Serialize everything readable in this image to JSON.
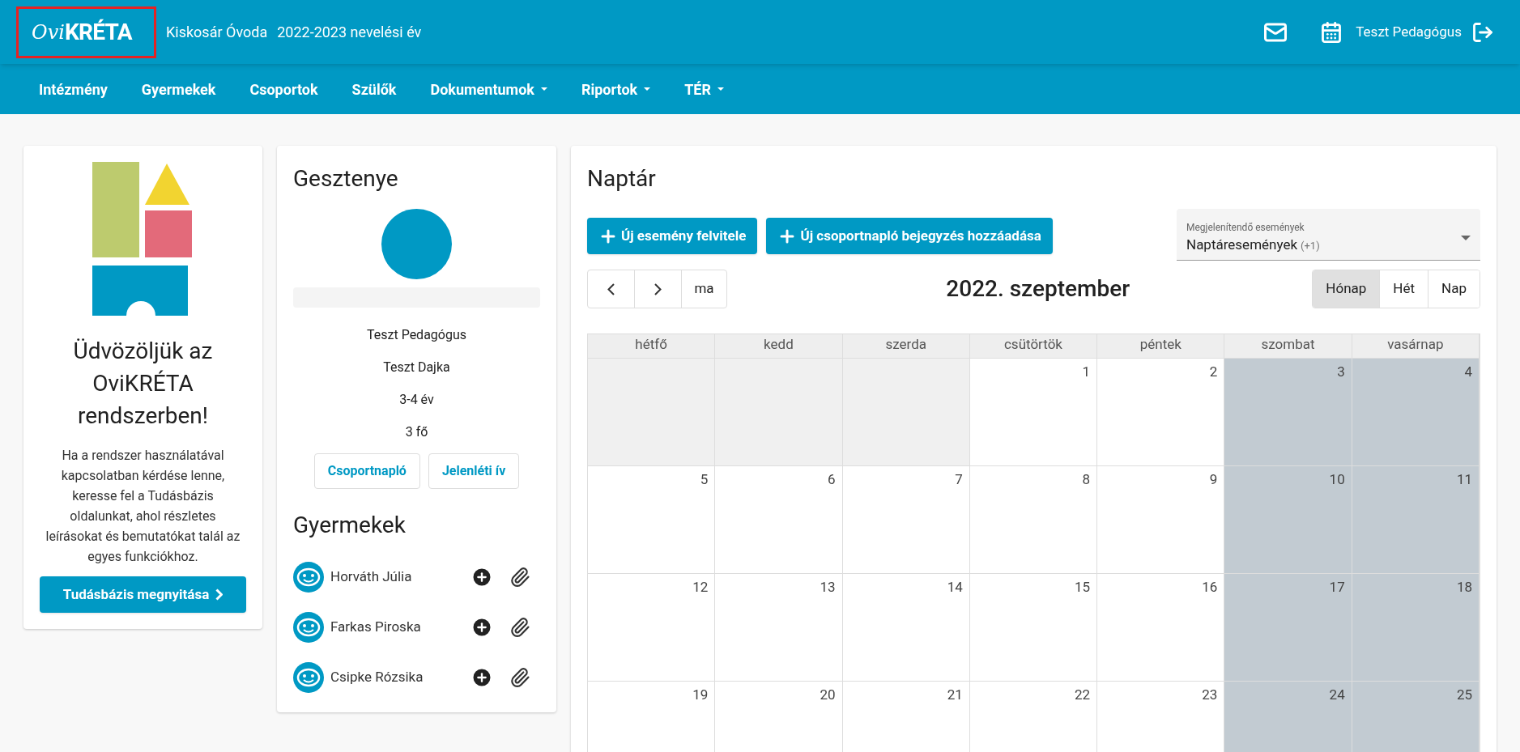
{
  "header": {
    "logo_prefix": "Ovi",
    "logo_main": "KRÉTA",
    "institution": "Kiskosár Óvoda",
    "year": "2022-2023 nevelési év",
    "user": "Teszt Pedagógus"
  },
  "nav": [
    {
      "label": "Intézmény",
      "dropdown": false
    },
    {
      "label": "Gyermekek",
      "dropdown": false
    },
    {
      "label": "Csoportok",
      "dropdown": false
    },
    {
      "label": "Szülők",
      "dropdown": false
    },
    {
      "label": "Dokumentumok",
      "dropdown": true
    },
    {
      "label": "Riportok",
      "dropdown": true
    },
    {
      "label": "TÉR",
      "dropdown": true
    }
  ],
  "welcome": {
    "title": "Üdvözöljük az OviKRÉTA rendszerben!",
    "text": "Ha a rendszer használatával kapcsolatban kérdése lenne, keresse fel a Tudásbázis oldalunkat, ahol részletes leírásokat és bemutatókat talál az egyes funkciókhoz.",
    "button": "Tudásbázis megnyitása"
  },
  "group": {
    "name": "Gesztenye",
    "details": [
      "Teszt Pedagógus",
      "Teszt Dajka",
      "3-4 év",
      "3 fő"
    ],
    "buttons": [
      "Csoportnapló",
      "Jelenléti ív"
    ],
    "children_title": "Gyermekek",
    "children": [
      {
        "name": "Horváth Júlia"
      },
      {
        "name": "Farkas Piroska"
      },
      {
        "name": "Csipke Rózsika"
      }
    ]
  },
  "calendar": {
    "title": "Naptár",
    "actions": [
      "Új esemény felvitele",
      "Új csoportnapló bejegyzés hozzáadása"
    ],
    "filter": {
      "label": "Megjelenítendő események",
      "value": "Naptáresemények",
      "extra": "(+1)"
    },
    "today": "ma",
    "month": "2022. szeptember",
    "views": [
      {
        "label": "Hónap",
        "selected": true
      },
      {
        "label": "Hét",
        "selected": false
      },
      {
        "label": "Nap",
        "selected": false
      }
    ],
    "weekdays": [
      "hétfő",
      "kedd",
      "szerda",
      "csütörtök",
      "péntek",
      "szombat",
      "vasárnap"
    ],
    "weeks": [
      [
        {
          "kind": "other"
        },
        {
          "kind": "other"
        },
        {
          "kind": "other"
        },
        {
          "kind": "day",
          "day": "1"
        },
        {
          "kind": "day",
          "day": "2"
        },
        {
          "kind": "weekend",
          "day": "3"
        },
        {
          "kind": "weekend",
          "day": "4"
        }
      ],
      [
        {
          "kind": "day",
          "day": "5"
        },
        {
          "kind": "day",
          "day": "6"
        },
        {
          "kind": "day",
          "day": "7"
        },
        {
          "kind": "day",
          "day": "8"
        },
        {
          "kind": "day",
          "day": "9"
        },
        {
          "kind": "weekend",
          "day": "10"
        },
        {
          "kind": "weekend",
          "day": "11"
        }
      ],
      [
        {
          "kind": "day",
          "day": "12"
        },
        {
          "kind": "day",
          "day": "13"
        },
        {
          "kind": "day",
          "day": "14"
        },
        {
          "kind": "day",
          "day": "15"
        },
        {
          "kind": "day",
          "day": "16"
        },
        {
          "kind": "weekend",
          "day": "17"
        },
        {
          "kind": "weekend",
          "day": "18"
        }
      ],
      [
        {
          "kind": "day",
          "day": "19"
        },
        {
          "kind": "day",
          "day": "20"
        },
        {
          "kind": "day",
          "day": "21"
        },
        {
          "kind": "day",
          "day": "22"
        },
        {
          "kind": "day",
          "day": "23"
        },
        {
          "kind": "weekend",
          "day": "24"
        },
        {
          "kind": "weekend",
          "day": "25"
        }
      ]
    ]
  }
}
